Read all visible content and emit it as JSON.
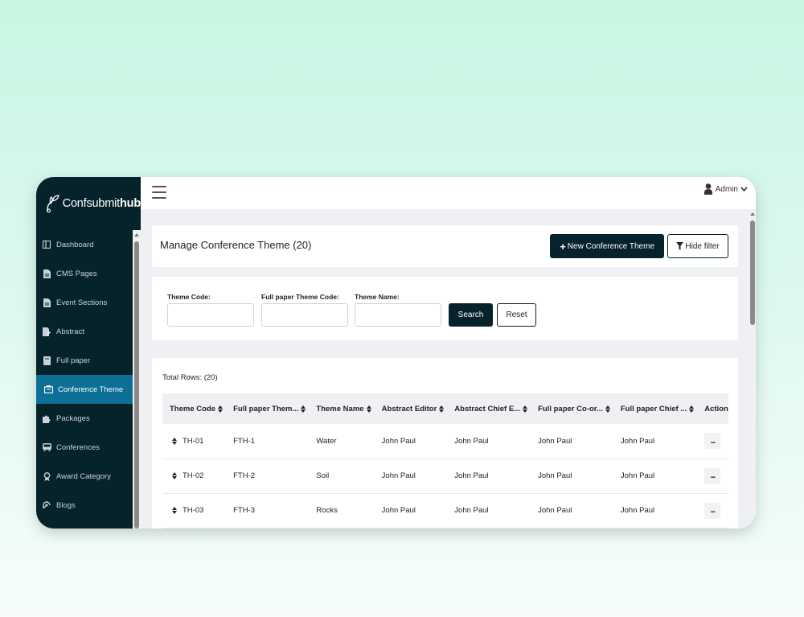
{
  "brand": {
    "prefix": "Confsubmit",
    "suffix": "hub"
  },
  "sidebar": {
    "items": [
      {
        "label": "Dashboard",
        "icon": "dashboard-icon",
        "active": false
      },
      {
        "label": "CMS Pages",
        "icon": "document-icon",
        "active": false
      },
      {
        "label": "Event Sections",
        "icon": "document-icon",
        "active": false
      },
      {
        "label": "Abstract",
        "icon": "document-edit-icon",
        "active": false
      },
      {
        "label": "Full paper",
        "icon": "paper-icon",
        "active": false
      },
      {
        "label": "Conference Theme",
        "icon": "theme-icon",
        "active": true
      },
      {
        "label": "Packages",
        "icon": "puzzle-icon",
        "active": false
      },
      {
        "label": "Conferences",
        "icon": "bus-icon",
        "active": false
      },
      {
        "label": "Award Category",
        "icon": "award-icon",
        "active": false
      },
      {
        "label": "Blogs",
        "icon": "blog-icon",
        "active": false
      }
    ]
  },
  "header": {
    "user_label": "Admin"
  },
  "page": {
    "title": "Manage Conference Theme (20)",
    "new_button": "New Conference Theme",
    "hide_filter_button": "Hide filter"
  },
  "filter": {
    "theme_code_label": "Theme Code:",
    "full_paper_code_label": "Full paper Theme Code:",
    "theme_name_label": "Theme Name:",
    "theme_code_value": "",
    "full_paper_code_value": "",
    "theme_name_value": "",
    "search_button": "Search",
    "reset_button": "Reset"
  },
  "table": {
    "total_rows": "Total Rows: (20)",
    "columns": [
      "Theme Code",
      "Full paper Them...",
      "Theme Name",
      "Abstract Editor",
      "Abstract Chief E...",
      "Full paper Co-or...",
      "Full paper Chief ...",
      "Action"
    ],
    "rows": [
      [
        "TH-01",
        "FTH-1",
        "Water",
        "John Paul",
        "John Paul",
        "John Paul",
        "John Paul",
        "..."
      ],
      [
        "TH-02",
        "FTH-2",
        "Soil",
        "John Paul",
        "John Paul",
        "John Paul",
        "John Paul",
        "..."
      ],
      [
        "TH-03",
        "FTH-3",
        "Rocks",
        "John Paul",
        "John Paul",
        "John Paul",
        "John Paul",
        "..."
      ]
    ]
  },
  "colors": {
    "sidebar": "#06222a",
    "active": "#0b6f96",
    "primary_button": "#06222a"
  }
}
